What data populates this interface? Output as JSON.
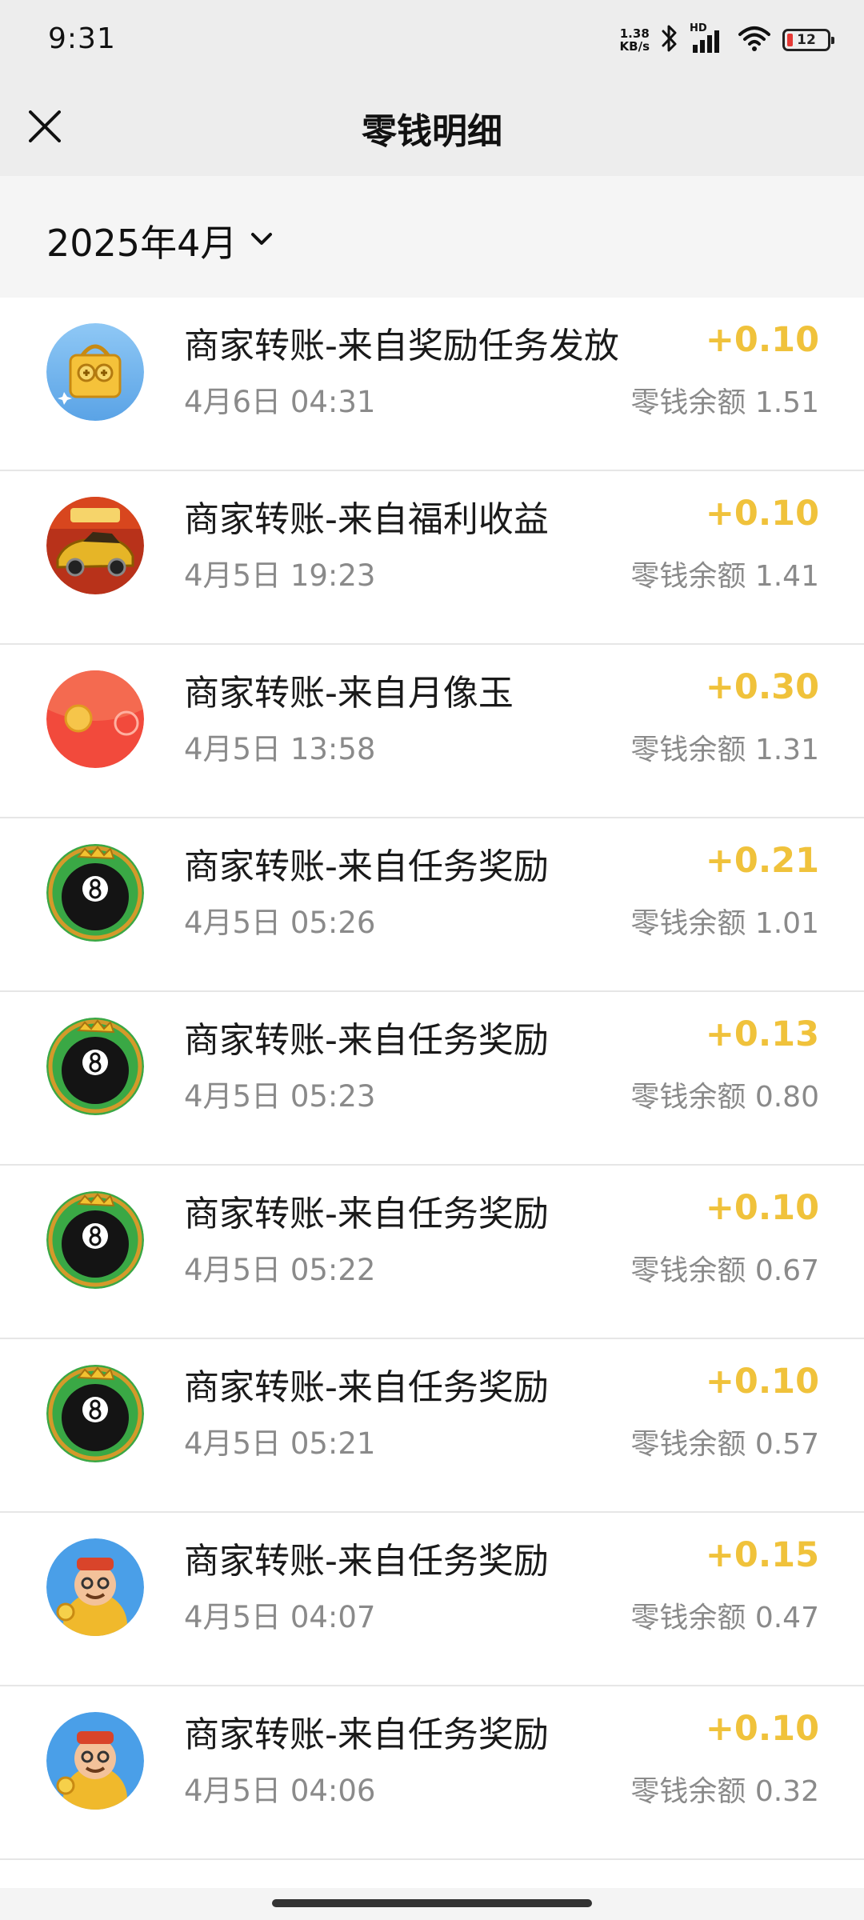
{
  "status_bar": {
    "time": "9:31",
    "net_speed_value": "1.38",
    "net_speed_unit": "KB/s",
    "battery_level": "12",
    "battery_color": "#e53935",
    "signal_label": "HD"
  },
  "header": {
    "title": "零钱明细"
  },
  "filter": {
    "month": "2025年4月"
  },
  "colors": {
    "amount": "#f0c23b",
    "secondary_text": "#8a8a8a",
    "header_bg": "#ededed"
  },
  "transactions": [
    {
      "icon": "gold-gift-box-icon",
      "title": "商家转账-来自奖励任务发放",
      "time": "4月6日 04:31",
      "amount": "+0.10",
      "balance": "零钱余额 1.51"
    },
    {
      "icon": "gold-sports-car-icon",
      "title": "商家转账-来自福利收益",
      "time": "4月5日 19:23",
      "amount": "+0.10",
      "balance": "零钱余额 1.41"
    },
    {
      "icon": "red-envelope-icon",
      "title": "商家转账-来自月像玉",
      "time": "4月5日 13:58",
      "amount": "+0.30",
      "balance": "零钱余额 1.31"
    },
    {
      "icon": "eight-ball-icon",
      "title": "商家转账-来自任务奖励",
      "time": "4月5日 05:26",
      "amount": "+0.21",
      "balance": "零钱余额 1.01"
    },
    {
      "icon": "eight-ball-icon",
      "title": "商家转账-来自任务奖励",
      "time": "4月5日 05:23",
      "amount": "+0.13",
      "balance": "零钱余额 0.80"
    },
    {
      "icon": "eight-ball-icon",
      "title": "商家转账-来自任务奖励",
      "time": "4月5日 05:22",
      "amount": "+0.10",
      "balance": "零钱余额 0.67"
    },
    {
      "icon": "eight-ball-icon",
      "title": "商家转账-来自任务奖励",
      "time": "4月5日 05:21",
      "amount": "+0.10",
      "balance": "零钱余额 0.57"
    },
    {
      "icon": "cartoon-rich-man-icon",
      "title": "商家转账-来自任务奖励",
      "time": "4月5日 04:07",
      "amount": "+0.15",
      "balance": "零钱余额 0.47"
    },
    {
      "icon": "cartoon-rich-man-icon",
      "title": "商家转账-来自任务奖励",
      "time": "4月5日 04:06",
      "amount": "+0.10",
      "balance": "零钱余额 0.32"
    }
  ]
}
